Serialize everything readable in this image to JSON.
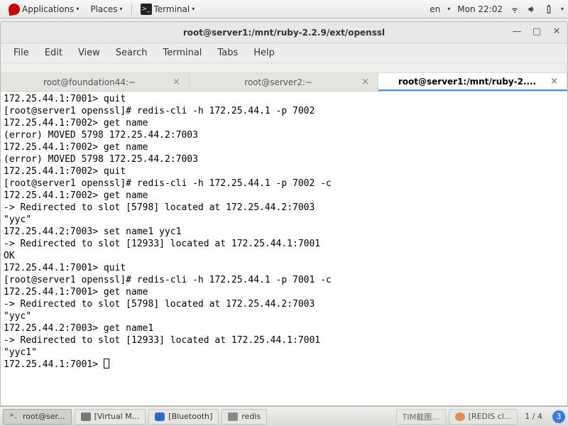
{
  "topbar": {
    "applications": "Applications",
    "places": "Places",
    "terminal": "Terminal",
    "lang": "en",
    "clock": "Mon 22:02"
  },
  "window": {
    "title": "root@server1:/mnt/ruby-2.2.9/ext/openssl",
    "menus": [
      "File",
      "Edit",
      "View",
      "Search",
      "Terminal",
      "Tabs",
      "Help"
    ],
    "tabs": [
      {
        "label": "root@foundation44:~",
        "active": false
      },
      {
        "label": "root@server2:~",
        "active": false
      },
      {
        "label": "root@server1:/mnt/ruby-2....",
        "active": true
      }
    ],
    "terminal_lines": [
      "172.25.44.1:7001> quit",
      "[root@server1 openssl]# redis-cli -h 172.25.44.1 -p 7002",
      "172.25.44.1:7002> get name",
      "(error) MOVED 5798 172.25.44.2:7003",
      "172.25.44.1:7002> get name",
      "(error) MOVED 5798 172.25.44.2:7003",
      "172.25.44.1:7002> quit",
      "[root@server1 openssl]# redis-cli -h 172.25.44.1 -p 7002 -c",
      "172.25.44.1:7002> get name",
      "-> Redirected to slot [5798] located at 172.25.44.2:7003",
      "\"yyc\"",
      "172.25.44.2:7003> set name1 yyc1",
      "-> Redirected to slot [12933] located at 172.25.44.1:7001",
      "OK",
      "172.25.44.1:7001> quit",
      "[root@server1 openssl]# redis-cli -h 172.25.44.1 -p 7001 -c",
      "172.25.44.1:7001> get name",
      "-> Redirected to slot [5798] located at 172.25.44.2:7003",
      "\"yyc\"",
      "172.25.44.2:7003> get name1",
      "-> Redirected to slot [12933] located at 172.25.44.1:7001",
      "\"yyc1\"",
      "172.25.44.1:7001> "
    ]
  },
  "taskbar": {
    "tasks": [
      {
        "label": "root@ser..."
      },
      {
        "label": "[Virtual M..."
      },
      {
        "label": "[Bluetooth]"
      },
      {
        "label": "redis"
      },
      {
        "label": "TIM截图..."
      },
      {
        "label": "[REDIS cl..."
      }
    ],
    "workspace": "1 / 4",
    "badge": "3"
  }
}
